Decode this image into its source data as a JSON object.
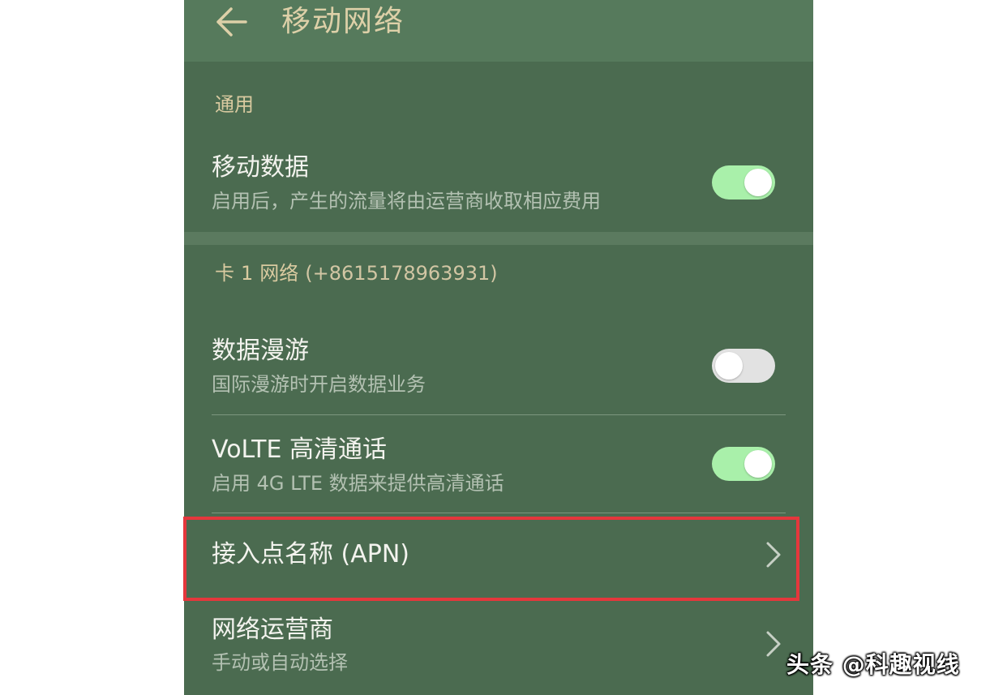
{
  "header": {
    "title": "移动网络",
    "back_icon": "arrow-left-icon"
  },
  "sections": {
    "general": {
      "label": "通用"
    },
    "sim1": {
      "label_prefix": "卡",
      "sim_number": "1",
      "label_suffix": "网络",
      "phone": "(+8615178963931)"
    }
  },
  "rows": {
    "mobile_data": {
      "title": "移动数据",
      "subtitle": "启用后，产生的流量将由运营商收取相应费用",
      "enabled": true
    },
    "data_roaming": {
      "title": "数据漫游",
      "subtitle": "国际漫游时开启数据业务",
      "enabled": false
    },
    "volte": {
      "title": "VoLTE 高清通话",
      "subtitle": "启用 4G LTE 数据来提供高清通话",
      "enabled": true
    },
    "apn": {
      "title": "接入点名称 (APN)"
    },
    "operator": {
      "title": "网络运营商",
      "subtitle": "手动或自动选择"
    }
  },
  "watermark": {
    "text": "头条 @科趣视线"
  },
  "colors": {
    "background": "#4b6b50",
    "topbar": "#567a5c",
    "accent_text": "#d9caa0",
    "toggle_on": "#a9f0aa",
    "toggle_off": "#e2e2e2",
    "highlight_border": "#e5373c"
  }
}
